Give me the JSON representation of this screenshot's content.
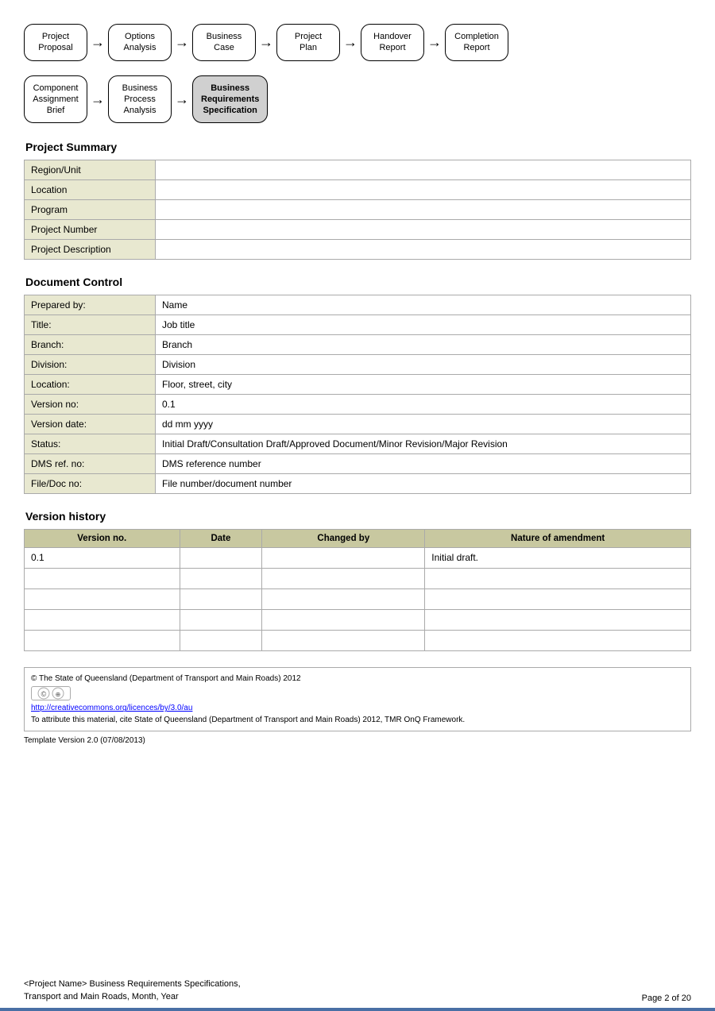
{
  "flow1": {
    "nodes": [
      {
        "label": "Project\nProposal",
        "active": false
      },
      {
        "label": "Options\nAnalysis",
        "active": false
      },
      {
        "label": "Business\nCase",
        "active": false
      },
      {
        "label": "Project\nPlan",
        "active": false
      },
      {
        "label": "Handover\nReport",
        "active": false
      },
      {
        "label": "Completion\nReport",
        "active": false
      }
    ]
  },
  "flow2": {
    "nodes": [
      {
        "label": "Component\nAssignment\nBrief",
        "active": false
      },
      {
        "label": "Business\nProcess\nAnalysis",
        "active": false
      },
      {
        "label": "Business\nRequirements\nSpecification",
        "active": true
      }
    ]
  },
  "project_summary": {
    "heading": "Project Summary",
    "rows": [
      {
        "label": "Region/Unit",
        "value": ""
      },
      {
        "label": "Location",
        "value": ""
      },
      {
        "label": "Program",
        "value": ""
      },
      {
        "label": "Project Number",
        "value": ""
      },
      {
        "label": "Project Description",
        "value": ""
      }
    ]
  },
  "document_control": {
    "heading": "Document Control",
    "rows": [
      {
        "label": "Prepared by:",
        "value": "Name"
      },
      {
        "label": "Title:",
        "value": "Job title"
      },
      {
        "label": "Branch:",
        "value": "Branch"
      },
      {
        "label": "Division:",
        "value": "Division"
      },
      {
        "label": "Location:",
        "value": "Floor, street, city"
      },
      {
        "label": "Version no:",
        "value": "0.1"
      },
      {
        "label": "Version date:",
        "value": "dd mm yyyy"
      },
      {
        "label": "Status:",
        "value": "Initial Draft/Consultation Draft/Approved Document/Minor Revision/Major Revision"
      },
      {
        "label": "DMS ref. no:",
        "value": "DMS reference number"
      },
      {
        "label": "File/Doc no:",
        "value": "File number/document number"
      }
    ]
  },
  "version_history": {
    "heading": "Version history",
    "columns": [
      "Version no.",
      "Date",
      "Changed by",
      "Nature of amendment"
    ],
    "rows": [
      {
        "version": "0.1",
        "date": "",
        "changed_by": "",
        "amendment": "Initial draft."
      },
      {
        "version": "",
        "date": "",
        "changed_by": "",
        "amendment": ""
      },
      {
        "version": "",
        "date": "",
        "changed_by": "",
        "amendment": ""
      },
      {
        "version": "",
        "date": "",
        "changed_by": "",
        "amendment": ""
      },
      {
        "version": "",
        "date": "",
        "changed_by": "",
        "amendment": ""
      }
    ]
  },
  "footer": {
    "copyright": "© The State of Queensland (Department of Transport and Main Roads) 2012",
    "license_url": "http://creativecommons.org/licences/by/3.0/au",
    "attribution": "To attribute this material, cite State of Queensland (Department of Transport and Main Roads) 2012, TMR OnQ Framework.",
    "template_version": "Template Version 2.0 (07/08/2013)",
    "page_left": "<Project Name> Business Requirements Specifications,\nTransport and Main Roads, Month, Year",
    "page_right": "Page 2 of 20"
  }
}
